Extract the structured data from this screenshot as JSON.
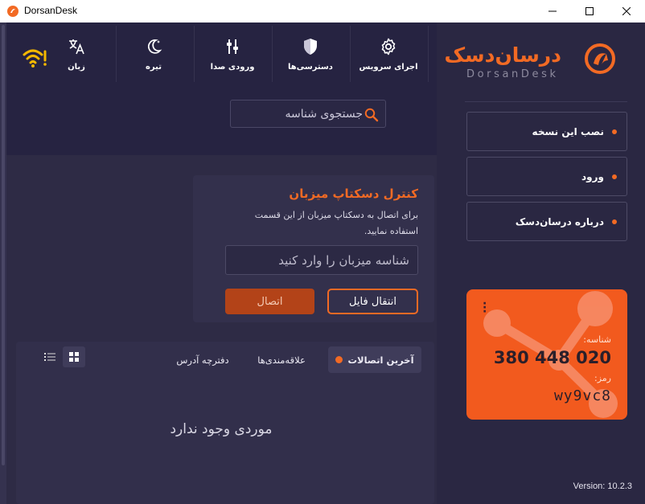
{
  "window": {
    "title": "DorsanDesk"
  },
  "toolbar": {
    "language_label": "زبان",
    "theme_label": "تیره",
    "audio_label": "ورودی صدا",
    "access_label": "دسترسی‌ها",
    "service_label": "اجرای سرویس"
  },
  "search": {
    "placeholder": "جستجوی شناسه"
  },
  "brand": {
    "name_fa": "درسان‌دسک",
    "name_en": "DorsanDesk"
  },
  "sidebar": {
    "items": [
      {
        "label": "نصب این نسخه"
      },
      {
        "label": "ورود"
      },
      {
        "label": "درباره درسان‌دسک"
      }
    ]
  },
  "id_card": {
    "id_label": "شناسه:",
    "id_value": "380 448 020",
    "password_label": "رمز:",
    "password_value": "wy9vc8"
  },
  "version": "Version: 10.2.3",
  "host": {
    "title": "کنترل دسکتاپ میزبان",
    "description": "برای اتصال به دسکتاپ میزبان از این قسمت استفاده نمایید.",
    "input_placeholder": "شناسه میزبان را وارد کنید",
    "file_transfer_label": "انتقال فایل",
    "connect_label": "اتصال"
  },
  "connections": {
    "tabs": [
      {
        "label": "آخرین اتصالات"
      },
      {
        "label": "علاقه‌مندی‌ها"
      },
      {
        "label": "دفترچه آدرس"
      }
    ],
    "empty_text": "موردی وجود ندارد"
  },
  "colors": {
    "accent": "#f26a24",
    "background": "#2e2b45",
    "header": "#262341",
    "sidebar": "#2a2742",
    "card": "#f25a1e",
    "warning": "#f5b800"
  },
  "icons": {
    "wifi": "wifi-warning-icon",
    "language": "translate-icon",
    "theme": "moon-icon",
    "audio": "audio-input-icon",
    "access": "shield-icon",
    "service": "gear-icon"
  }
}
